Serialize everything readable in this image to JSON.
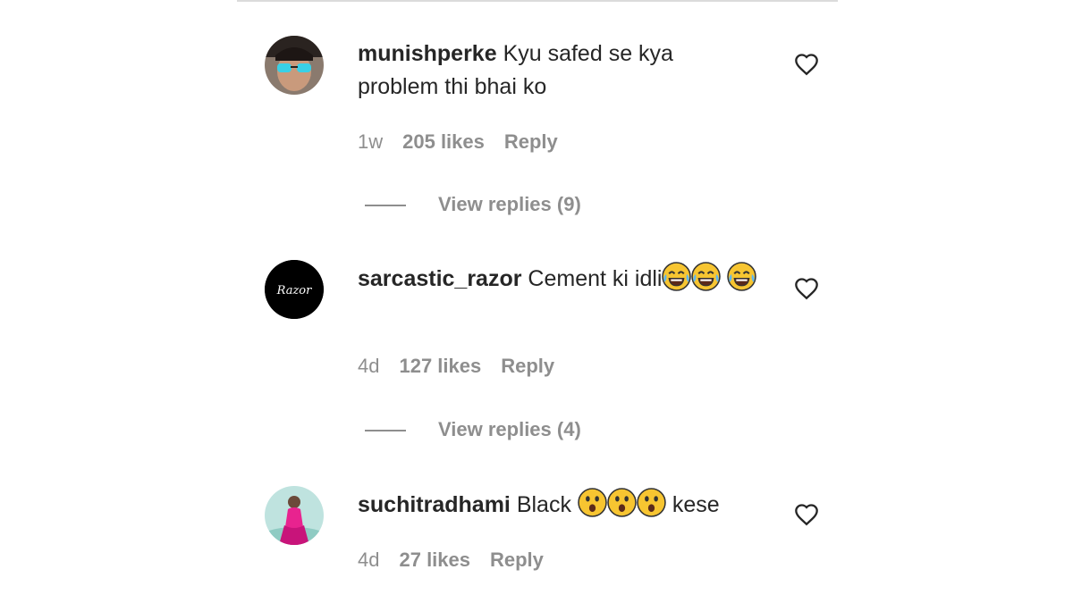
{
  "comments": [
    {
      "username": "munishperke",
      "text": "Kyu safed se kya problem thi bhai ko",
      "time": "1w",
      "likes": "205 likes",
      "reply_label": "Reply",
      "view_replies": "View replies (9)",
      "avatar_icon": "profile-photo-sunglasses"
    },
    {
      "username": "sarcastic_razor",
      "text": "Cement ki idli",
      "emoji": [
        "😂",
        "😂",
        "😂"
      ],
      "time": "4d",
      "likes": "127 likes",
      "reply_label": "Reply",
      "view_replies": "View replies (4)",
      "avatar_text": "Razor"
    },
    {
      "username": "suchitradhami",
      "text_before": "Black",
      "emoji": [
        "😮",
        "😮",
        "😮"
      ],
      "text_after": "kese",
      "time": "4d",
      "likes": "27 likes",
      "reply_label": "Reply",
      "avatar_icon": "profile-photo-pink-dress"
    }
  ],
  "colors": {
    "text": "#262626",
    "meta": "#8e8e8e",
    "divider": "#dbdbdb"
  }
}
